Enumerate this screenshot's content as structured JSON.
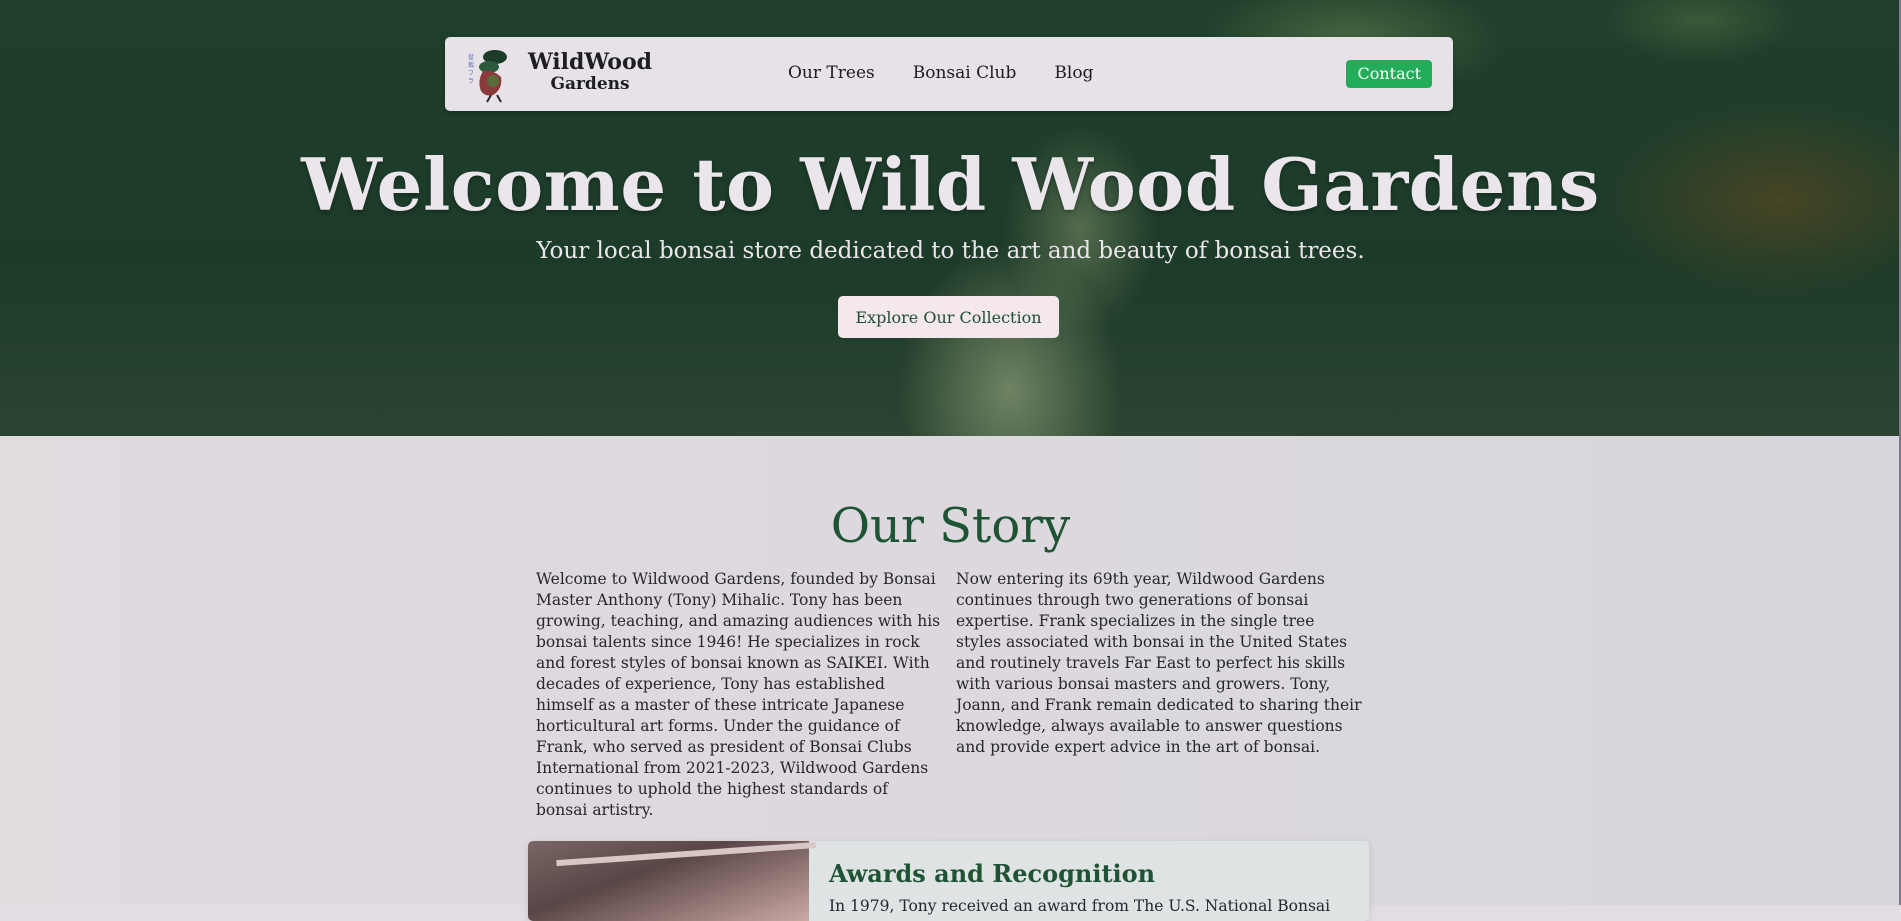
{
  "nav": {
    "logo_line1": "WildWood",
    "logo_line2": "Gardens",
    "links": [
      "Our Trees",
      "Bonsai Club",
      "Blog"
    ],
    "contact_label": "Contact"
  },
  "hero": {
    "title": "Welcome to Wild Wood Gardens",
    "subtitle": "Your local bonsai store dedicated to the art and beauty of bonsai trees.",
    "cta_label": "Explore Our Collection"
  },
  "story": {
    "title": "Our Story",
    "left": "Welcome to Wildwood Gardens, founded by Bonsai Master Anthony (Tony) Mihalic. Tony has been growing, teaching, and amazing audiences with his bonsai talents since 1946! He specializes in rock and forest styles of bonsai known as SAIKEI. With decades of experience, Tony has established himself as a master of these intricate Japanese horticultural art forms. Under the guidance of Frank, who served as president of Bonsai Clubs International from 2021-2023, Wildwood Gardens continues to uphold the highest standards of bonsai artistry.",
    "right": "Now entering its 69th year, Wildwood Gardens continues through two generations of bonsai expertise. Frank specializes in the single tree styles associated with bonsai in the United States and routinely travels Far East to perfect his skills with various bonsai masters and growers. Tony, Joann, and Frank remain dedicated to sharing their knowledge, always available to answer questions and provide expert advice in the art of bonsai."
  },
  "awards": {
    "title": "Awards and Recognition",
    "text": "In 1979, Tony received an award from The U.S. National Bonsai"
  },
  "colors": {
    "accent_green": "#1e5434",
    "contact_green": "#23ac5a",
    "hero_dark": "#1d3b29"
  }
}
